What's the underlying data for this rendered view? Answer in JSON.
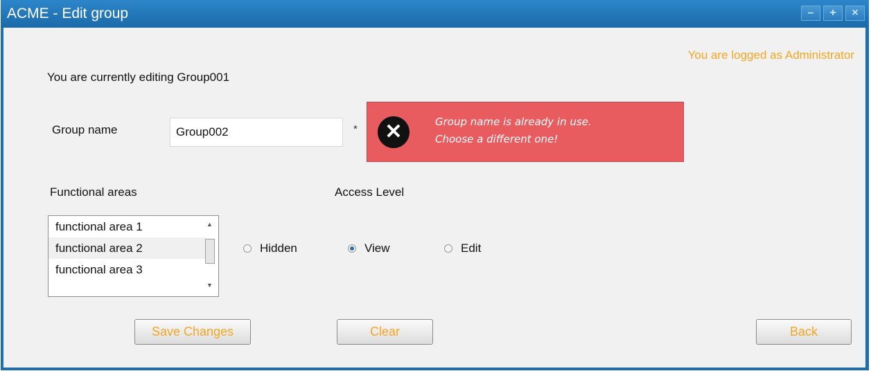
{
  "window": {
    "title": "ACME - Edit group",
    "controls": {
      "minimize": "–",
      "maximize": "+",
      "close": "×"
    }
  },
  "header": {
    "logged_as": "You are logged as Administrator"
  },
  "editing_label": "You are currently editing Group001",
  "group_name": {
    "label": "Group name",
    "value": "Group002",
    "required_mark": "*"
  },
  "error": {
    "icon": "close-icon",
    "line1": "Group name is already in use.",
    "line2": "Choose a different one!",
    "color": "#e85c60"
  },
  "functional_areas": {
    "label": "Functional areas",
    "items": [
      "functional area 1",
      "functional area 2",
      "functional area 3"
    ]
  },
  "access_level": {
    "label": "Access Level",
    "options": [
      "Hidden",
      "View",
      "Edit"
    ],
    "selected": "View"
  },
  "buttons": {
    "save": "Save Changes",
    "clear": "Clear",
    "back": "Back"
  },
  "colors": {
    "accent": "#f5a623",
    "titlebar": "#1f6faf"
  }
}
